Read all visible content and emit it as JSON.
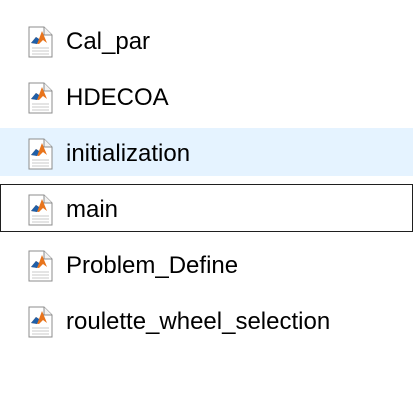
{
  "files": [
    {
      "name": "Cal_par",
      "icon": "matlab-file-icon",
      "state": "normal"
    },
    {
      "name": "HDECOA",
      "icon": "matlab-file-icon",
      "state": "normal"
    },
    {
      "name": "initialization",
      "icon": "matlab-file-icon",
      "state": "hovered"
    },
    {
      "name": "main",
      "icon": "matlab-file-icon",
      "state": "focused"
    },
    {
      "name": "Problem_Define",
      "icon": "matlab-file-icon",
      "state": "normal"
    },
    {
      "name": "roulette_wheel_selection",
      "icon": "matlab-file-icon",
      "state": "normal"
    }
  ],
  "colors": {
    "hover_background": "#e5f3ff",
    "focus_border": "#1f1f1f",
    "matlab_orange": "#e8741c",
    "matlab_blue": "#1f5fa8"
  }
}
